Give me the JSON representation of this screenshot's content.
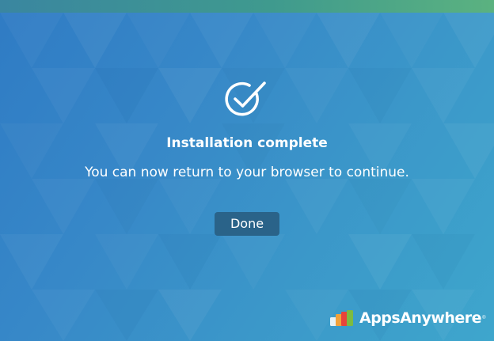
{
  "dialog": {
    "title": "Installation complete",
    "message": "You can now return to your browser to continue.",
    "done_label": "Done"
  },
  "brand": {
    "name": "AppsAnywhere",
    "trademark": "®",
    "logo_colors": [
      "#e9f2f5",
      "#f2a23a",
      "#e8443a",
      "#7dbb41"
    ]
  },
  "icons": {
    "status": "check-circle-icon"
  },
  "colors": {
    "background_start": "#2f7bc4",
    "background_end": "#3ea6cc",
    "button": "#2a6389",
    "text": "#ffffff"
  }
}
